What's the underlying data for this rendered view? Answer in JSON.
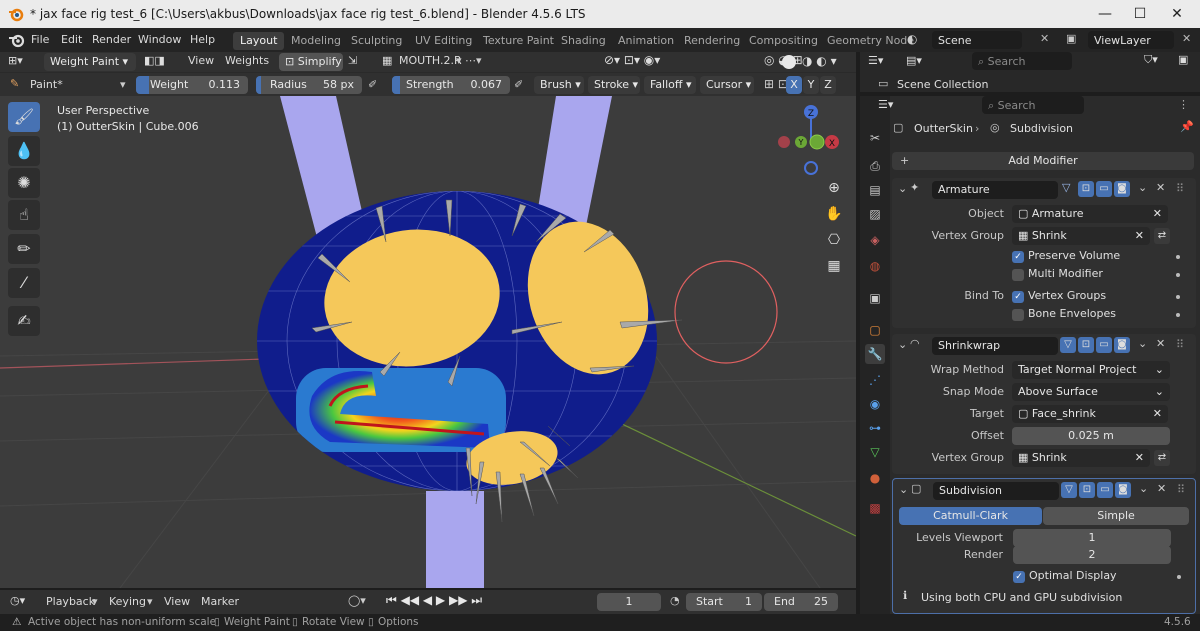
{
  "window": {
    "title": "* jax face rig test_6 [C:\\Users\\akbus\\Downloads\\jax face rig test_6.blend] - Blender 4.5.6 LTS",
    "minimize": "—",
    "maximize": "☐",
    "close": "✕"
  },
  "menu": {
    "file": "File",
    "edit": "Edit",
    "render": "Render",
    "window": "Window",
    "help": "Help"
  },
  "workspaces": [
    "Layout",
    "Modeling",
    "Sculpting",
    "UV Editing",
    "Texture Paint",
    "Shading",
    "Animation",
    "Rendering",
    "Compositing",
    "Geometry Node"
  ],
  "scene": {
    "name": "Scene",
    "view_layer": "ViewLayer"
  },
  "viewport_header": {
    "mode": "Weight Paint",
    "view": "View",
    "weights": "Weights",
    "simplify": "Simplify",
    "vgroup": "MOUTH.2.R"
  },
  "tool_header": {
    "brush_name": "Paint*",
    "weight_label": "Weight",
    "weight_value": "0.113",
    "weight_fraction": 0.113,
    "radius_label": "Radius",
    "radius_value": "58 px",
    "strength_label": "Strength",
    "strength_value": "0.067",
    "strength_fraction": 0.067,
    "brush": "Brush",
    "stroke": "Stroke",
    "falloff": "Falloff",
    "cursor": "Cursor",
    "axis_x": "X",
    "axis_y": "Y",
    "axis_z": "Z"
  },
  "viewport": {
    "perspective": "User Perspective",
    "object_info": "(1) OutterSkin | Cube.006"
  },
  "gizmo": {
    "z": "Z",
    "y": "Y",
    "x": "X"
  },
  "timeline": {
    "playback": "Playback",
    "keying": "Keying",
    "view": "View",
    "marker": "Marker",
    "current_frame": "1",
    "start_label": "Start",
    "start": "1",
    "end_label": "End",
    "end": "25"
  },
  "outliner": {
    "search_placeholder": "Search",
    "scene_collection": "Scene Collection"
  },
  "properties": {
    "search_placeholder": "Search",
    "object_name": "OutterSkin",
    "modifier_context": "Subdivision",
    "add_modifier": "Add Modifier",
    "armature": {
      "name": "Armature",
      "object_label": "Object",
      "object_value": "Armature",
      "vgroup_label": "Vertex Group",
      "vgroup_value": "Shrink",
      "preserve_volume": "Preserve Volume",
      "preserve_volume_checked": true,
      "multi_modifier": "Multi Modifier",
      "multi_modifier_checked": false,
      "bind_to_label": "Bind To",
      "vertex_groups": "Vertex Groups",
      "vertex_groups_checked": true,
      "bone_envelopes": "Bone Envelopes",
      "bone_envelopes_checked": false
    },
    "shrinkwrap": {
      "name": "Shrinkwrap",
      "wrap_method_label": "Wrap Method",
      "wrap_method": "Target Normal Project",
      "snap_mode_label": "Snap Mode",
      "snap_mode": "Above Surface",
      "target_label": "Target",
      "target": "Face_shrink",
      "offset_label": "Offset",
      "offset": "0.025 m",
      "vgroup_label": "Vertex Group",
      "vgroup": "Shrink"
    },
    "subdivision": {
      "name": "Subdivision",
      "catmull": "Catmull-Clark",
      "simple": "Simple",
      "levels_viewport_label": "Levels Viewport",
      "levels_viewport": "1",
      "render_label": "Render",
      "render": "2",
      "optimal_display": "Optimal Display",
      "optimal_display_checked": true,
      "info": "Using both CPU and GPU subdivision"
    }
  },
  "status": {
    "warning": "Active object has non-uniform scale",
    "hint1": "Weight Paint",
    "hint2": "Rotate View",
    "hint3": "Options",
    "version": "4.5.6"
  },
  "colors": {
    "accent": "#4772b3",
    "mesh_blue": "#101d8c",
    "eye_yellow": "#f5c85a",
    "bone_lavender": "#a9a6ee",
    "brush_circle": "#e06060"
  }
}
